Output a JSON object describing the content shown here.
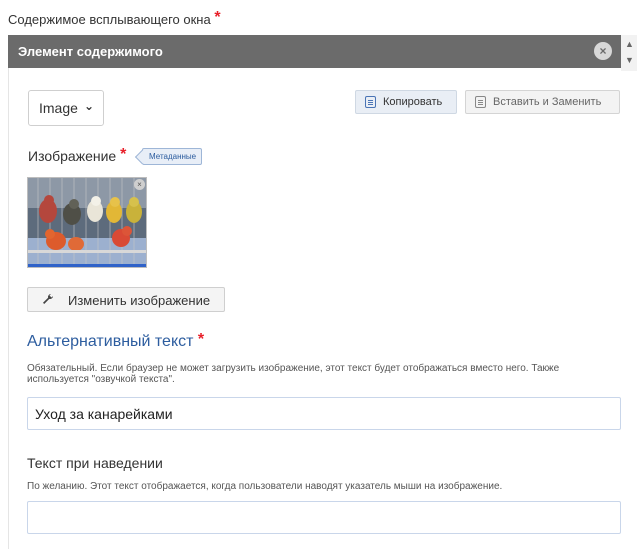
{
  "section": {
    "title": "Содержимое всплывающего окна",
    "required_mark": "*"
  },
  "panel": {
    "header_title": "Элемент содержимого",
    "close_icon": "×",
    "scroll_up": "▲",
    "scroll_down": "▼"
  },
  "toolbar": {
    "type_select_value": "Image",
    "copy_label": "Копировать",
    "paste_replace_label": "Вставить и Заменить"
  },
  "image_field": {
    "label": "Изображение",
    "required_mark": "*",
    "metadata_badge": "Метаданные",
    "remove_icon": "×",
    "change_button_label": "Изменить изображение"
  },
  "alt_text": {
    "title": "Альтернативный текст",
    "required_mark": "*",
    "help": "Обязательный. Если браузер не может загрузить изображение, этот текст будет отображаться вместо него. Также используется \"озвучкой текста\".",
    "value": "Уход за канарейками"
  },
  "hover_text": {
    "title": "Текст при наведении",
    "help": "По желанию. Этот текст отображается, когда пользователи наводят указатель мыши на изображение.",
    "value": ""
  }
}
